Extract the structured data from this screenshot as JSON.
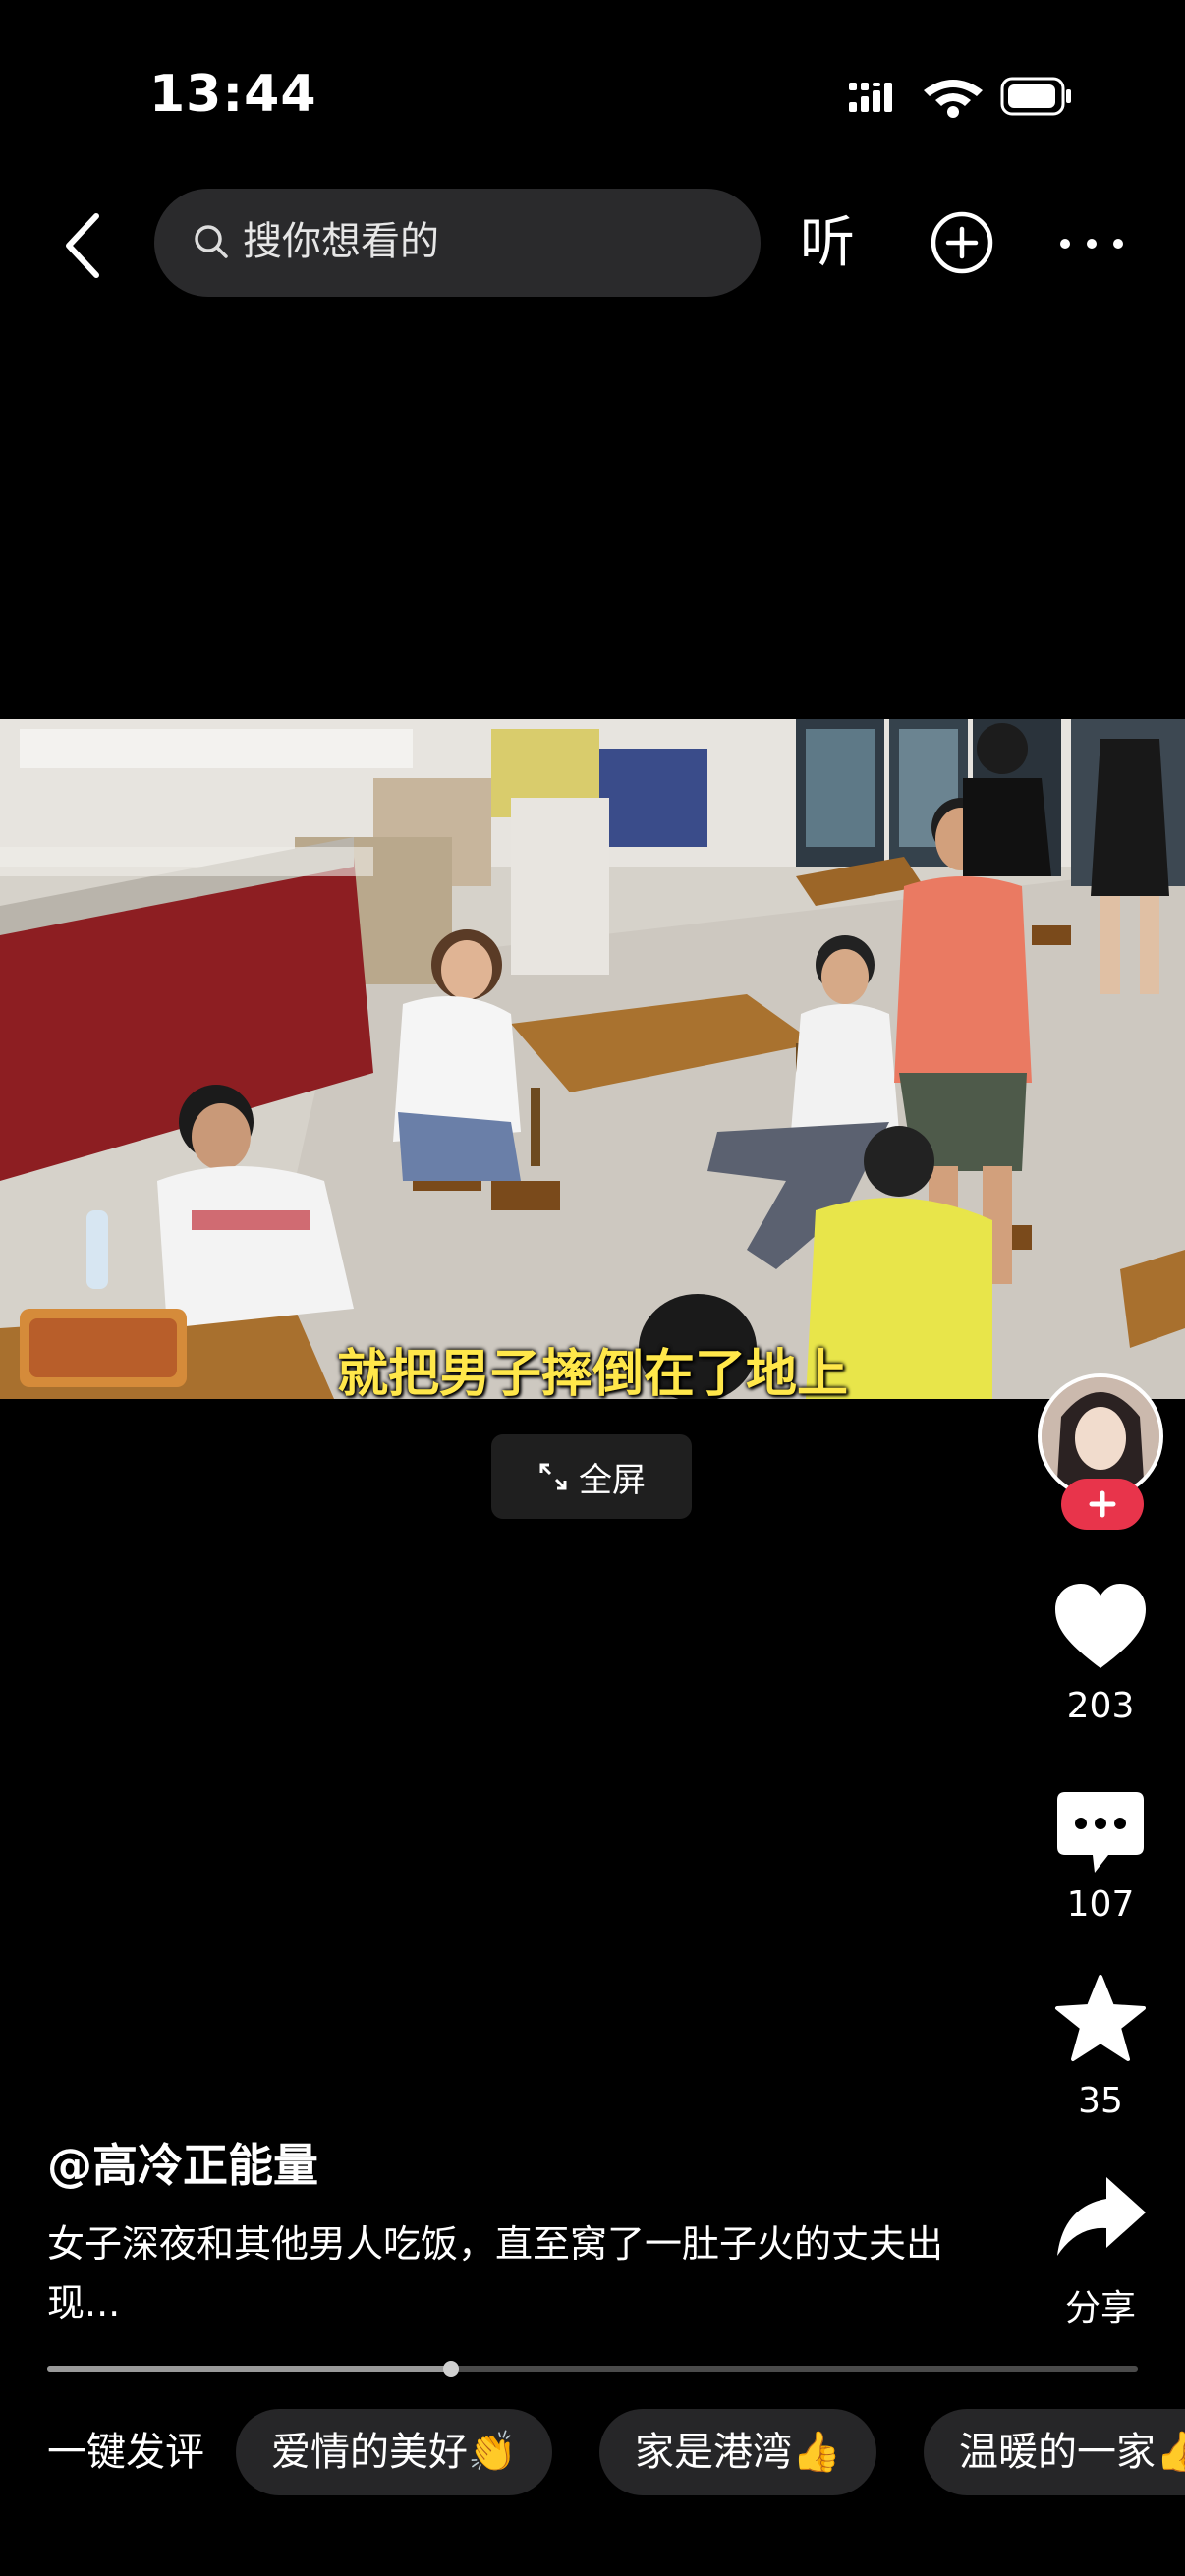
{
  "status_bar": {
    "time": "13:44"
  },
  "top_bar": {
    "search_placeholder": "搜你想看的",
    "listen_label": "听"
  },
  "video": {
    "subtitle": "就把男子摔倒在了地上",
    "fullscreen_label": "全屏"
  },
  "actions": {
    "likes": "203",
    "comments": "107",
    "favorites": "35",
    "share_label": "分享"
  },
  "post": {
    "author": "@高冷正能量",
    "description": "女子深夜和其他男人吃饭，直至窝了一肚子火的丈夫出现..."
  },
  "playback": {
    "progress_fraction": 0.37
  },
  "quick_comments": {
    "label": "一键发评",
    "chips": [
      "爱情的美好👏",
      "家是港湾👍",
      "温暖的一家👍"
    ]
  },
  "colors": {
    "accent": "#e8344b",
    "subtitle": "#ffe74a"
  }
}
